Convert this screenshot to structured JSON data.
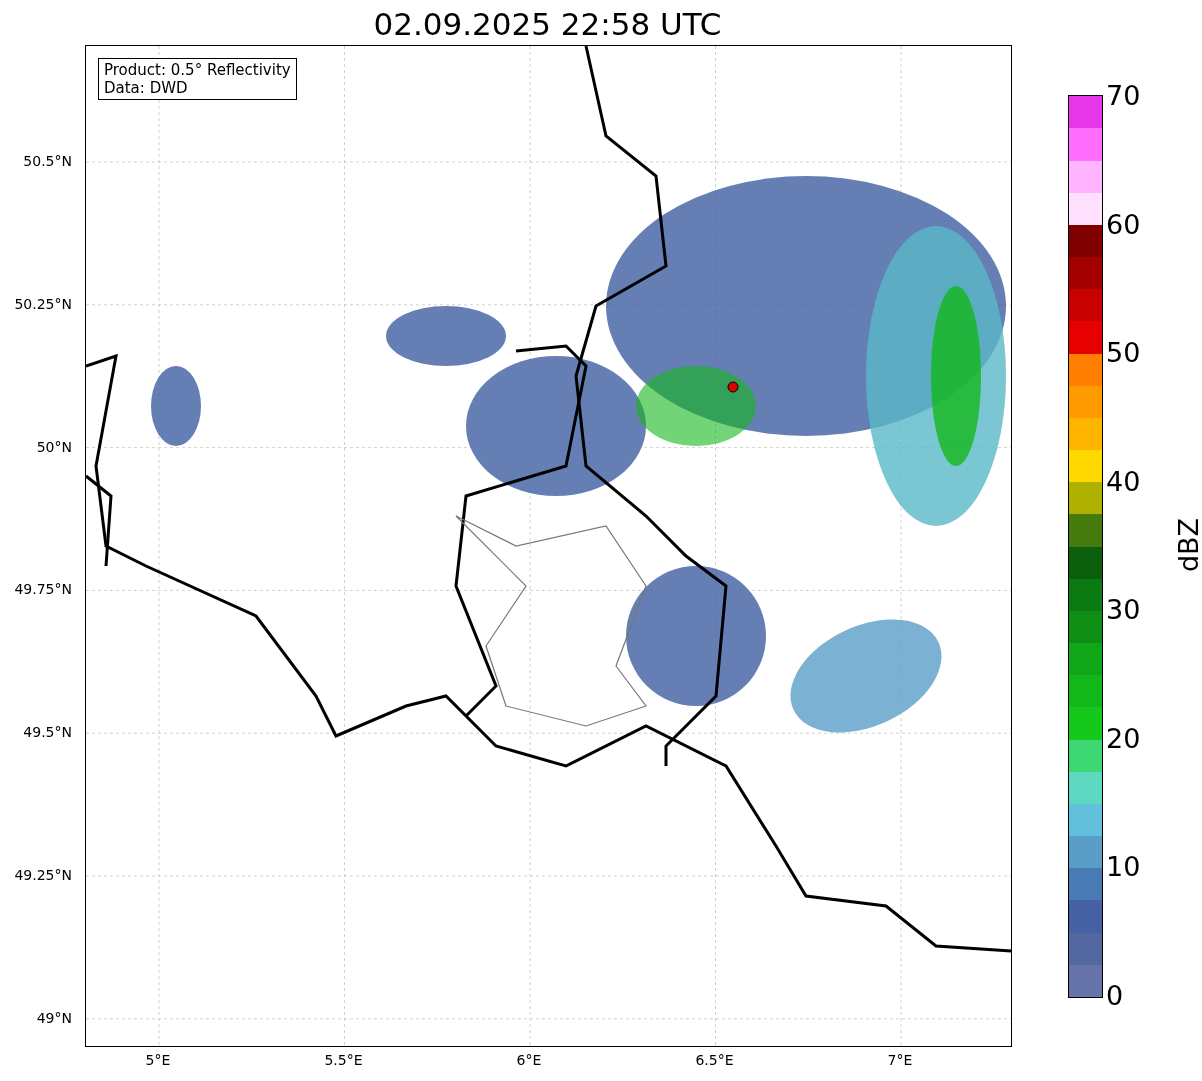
{
  "title": "02.09.2025 22:58 UTC",
  "map": {
    "legend": [
      "Product: 0.5° Reflectivity",
      "Data: DWD"
    ],
    "y_tick_labels": [
      "50.5°N",
      "50.25°N",
      "50°N",
      "49.75°N",
      "49.5°N",
      "49.25°N",
      "49°N"
    ],
    "x_tick_labels": [
      "5°E",
      "5.5°E",
      "6°E",
      "6.5°E",
      "7°E"
    ]
  },
  "colorbar": {
    "label": "dBZ",
    "tick_labels": [
      "70",
      "60",
      "50",
      "40",
      "30",
      "20",
      "10",
      "0"
    ],
    "segments": [
      {
        "color": "#6673a8"
      },
      {
        "color": "#5468a0"
      },
      {
        "color": "#4560a3"
      },
      {
        "color": "#4a7ab3"
      },
      {
        "color": "#5a9ec8"
      },
      {
        "color": "#62c0dc"
      },
      {
        "color": "#5ed8c0"
      },
      {
        "color": "#3dd874"
      },
      {
        "color": "#14c81c"
      },
      {
        "color": "#12b81a"
      },
      {
        "color": "#10a618"
      },
      {
        "color": "#0e8e14"
      },
      {
        "color": "#0c7a12"
      },
      {
        "color": "#0a5e0c"
      },
      {
        "color": "#457a0c"
      },
      {
        "color": "#b0b000"
      },
      {
        "color": "#ffd800"
      },
      {
        "color": "#ffb400"
      },
      {
        "color": "#ff9a00"
      },
      {
        "color": "#ff7e00"
      },
      {
        "color": "#e60000"
      },
      {
        "color": "#c80000"
      },
      {
        "color": "#a40000"
      },
      {
        "color": "#800000"
      },
      {
        "color": "#ffe0ff"
      },
      {
        "color": "#ffb4ff"
      },
      {
        "color": "#ff6eff"
      },
      {
        "color": "#e837e8"
      }
    ]
  }
}
